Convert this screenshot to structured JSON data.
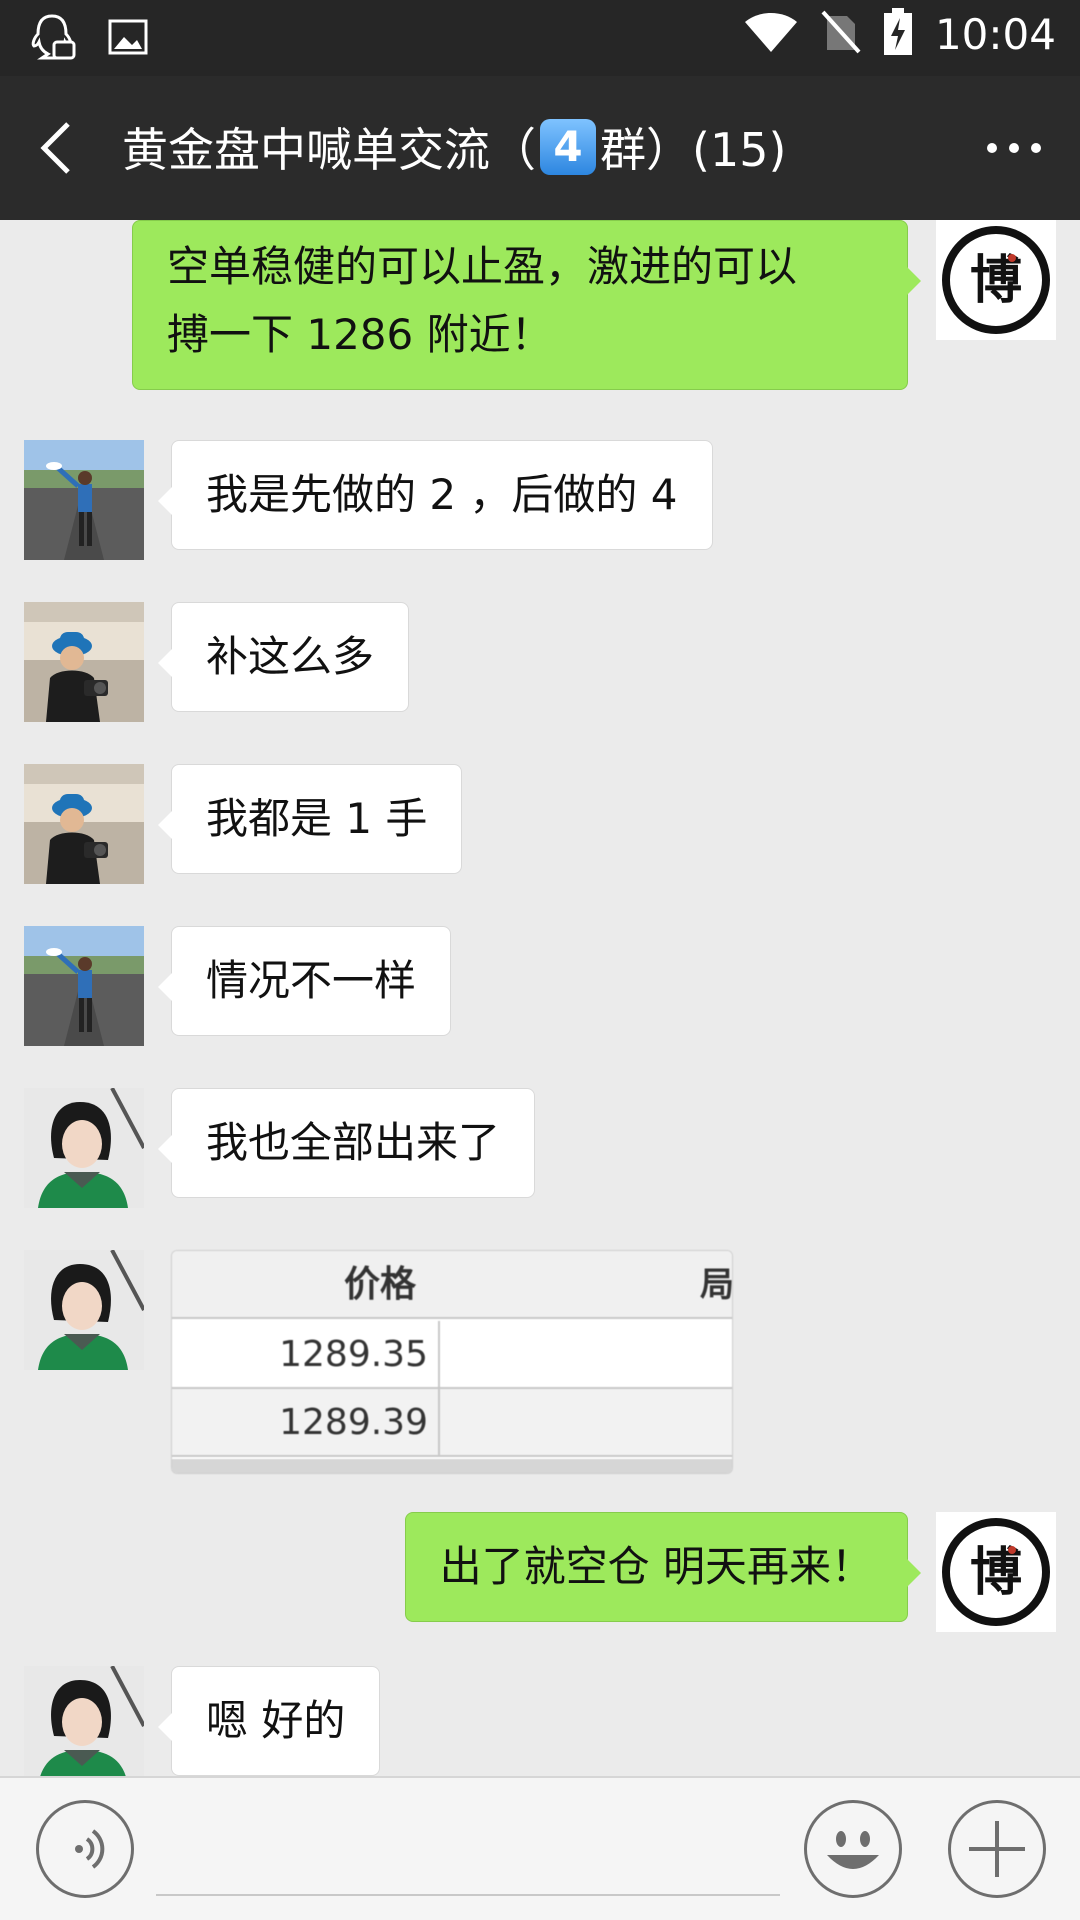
{
  "status_bar": {
    "time": "10:04",
    "icons": [
      "qq-notification-icon",
      "image-notification-icon",
      "wifi-icon",
      "no-sim-icon",
      "battery-charging-icon"
    ]
  },
  "header": {
    "back_icon": "back-arrow-icon",
    "title_prefix": "黄金盘中喊单交流（",
    "title_badge": "4",
    "title_suffix": "群）(15)",
    "more_icon": "more-dots-icon"
  },
  "messages": [
    {
      "side": "out",
      "sender": "博",
      "text_lines": [
        "空单稳健的可以止盈，激进的可以",
        "搏一下 1286 附近！"
      ]
    },
    {
      "side": "in",
      "avatar": "man-on-road",
      "text": "我是先做的 2 ，后做的 4"
    },
    {
      "side": "in",
      "avatar": "woman-blue-hat",
      "text": "补这么多"
    },
    {
      "side": "in",
      "avatar": "woman-blue-hat",
      "text": "我都是 1 手"
    },
    {
      "side": "in",
      "avatar": "man-on-road",
      "text": "情况不一样"
    },
    {
      "side": "in",
      "avatar": "woman-green-jacket",
      "text": "我也全部出来了"
    },
    {
      "side": "in",
      "avatar": "woman-green-jacket",
      "type": "image",
      "table": {
        "header": [
          "价格",
          "局"
        ],
        "rows": [
          "1289.35",
          "1289.39"
        ]
      }
    },
    {
      "side": "out",
      "sender": "博",
      "text": "出了就空仓 明天再来！"
    },
    {
      "side": "in",
      "avatar": "woman-green-jacket",
      "text": "嗯 好的"
    }
  ],
  "input_bar": {
    "voice_icon": "voice-icon",
    "emoji_icon": "emoji-icon",
    "plus_icon": "plus-icon"
  },
  "colors": {
    "outgoing_bubble": "#9de95c",
    "incoming_bubble": "#ffffff",
    "chat_background": "#ebebeb",
    "header_background": "#2b2b2b"
  }
}
